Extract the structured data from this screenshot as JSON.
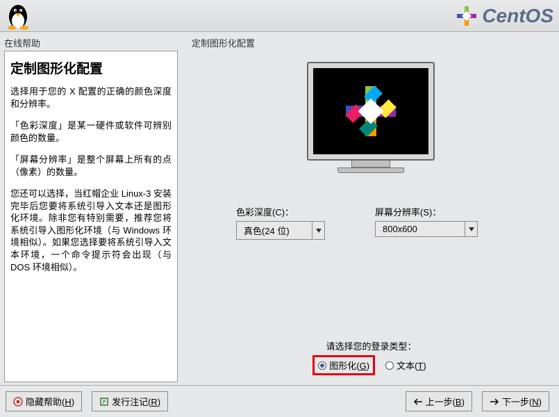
{
  "brand": "CentOS",
  "help": {
    "panel_label": "在线帮助",
    "heading": "定制图形化配置",
    "p1": "选择用于您的 X 配置的正确的颜色深度和分辨率。",
    "p2": "「色彩深度」是某一硬件或软件可辨别颜色的数量。",
    "p3": "「屏幕分辨率」是整个屏幕上所有的点（像素）的数量。",
    "p4": "您还可以选择，当红帽企业 Linux-3 安装完毕后您要将系统引导入文本还是图形化环境。除非您有特别需要，推荐您将系统引导入图形化环境（与 Windows 环境相似）。如果您选择要将系统引导入文本环境，一个命令提示符会出现（与 DOS 环境相似）。"
  },
  "main": {
    "panel_label": "定制图形化配置",
    "color_depth_label": "色彩深度(C)：",
    "color_depth_value": "真色(24 位)",
    "resolution_label": "屏幕分辨率(S)：",
    "resolution_value": "800x600",
    "login_type_label": "请选择您的登录类型：",
    "opt_graphical": "图形化(G)",
    "opt_text": "文本(T)"
  },
  "footer": {
    "hide_help": "隐藏帮助(H)",
    "release_notes": "发行注记(R)",
    "back": "上一步(B)",
    "next": "下一步(N)"
  }
}
